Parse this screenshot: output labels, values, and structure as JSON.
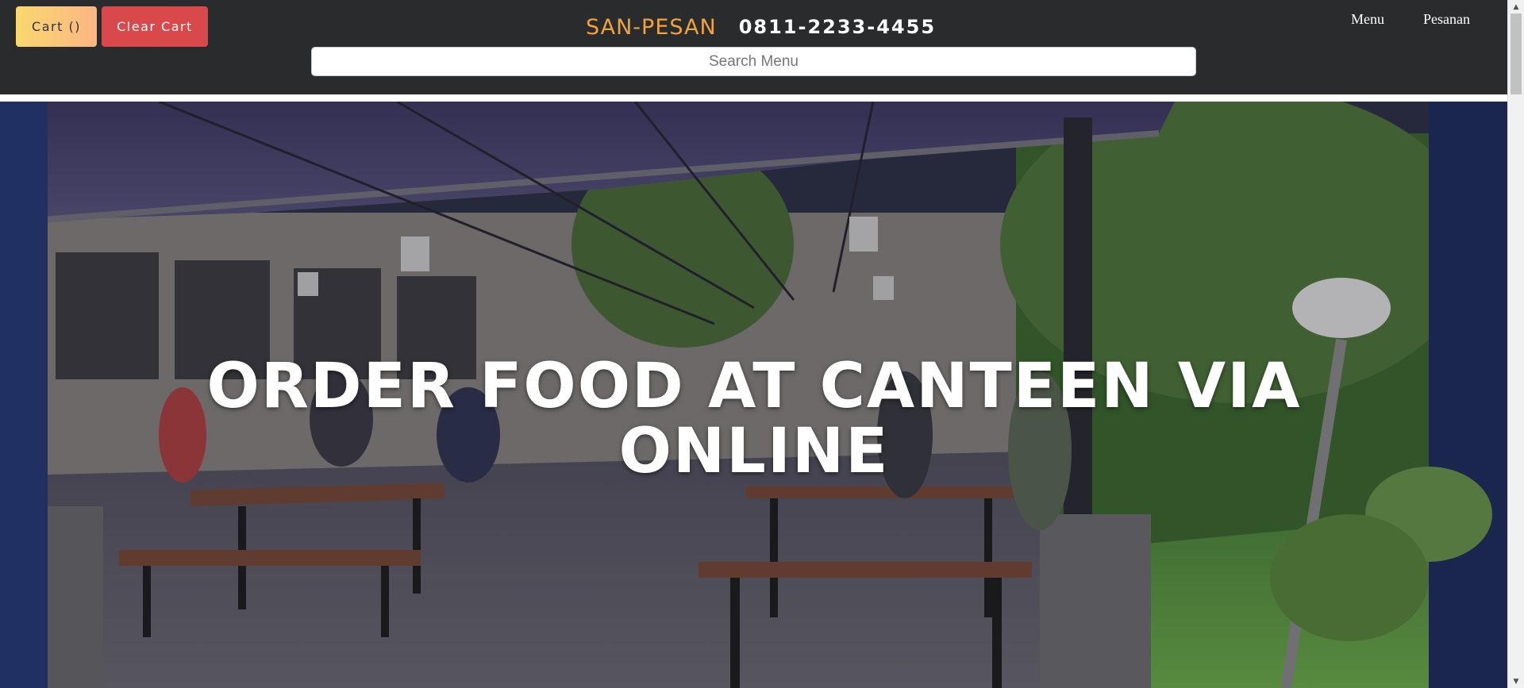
{
  "header": {
    "cart_label": "Cart ()",
    "clear_cart_label": "Clear Cart",
    "brand_name": "SAN-PESAN",
    "phone": "0811-2233-4455",
    "search_placeholder": "Search Menu",
    "search_value": "",
    "nav": {
      "menu": "Menu",
      "pesanan": "Pesanan"
    }
  },
  "hero": {
    "title": "ORDER FOOD AT CANTEEN VIA ONLINE"
  },
  "colors": {
    "header_bg": "#2a2b2d",
    "brand_accent": "#f0a33f",
    "cart_gradient_start": "#f9d86e",
    "cart_gradient_end": "#fcb683",
    "clear_cart_bg": "#d9484b"
  },
  "icons": {
    "scroll_up": "triangle-up-icon",
    "scroll_down": "triangle-down-icon"
  }
}
